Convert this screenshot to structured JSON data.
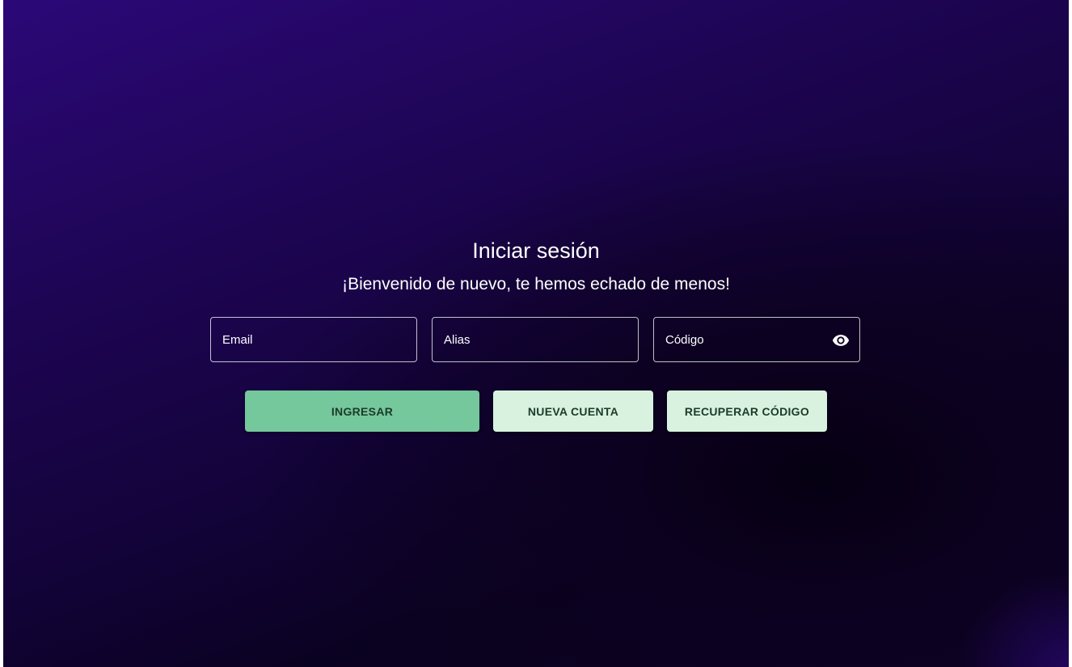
{
  "login": {
    "title": "Iniciar sesión",
    "subtitle": "¡Bienvenido de nuevo, te hemos echado de menos!"
  },
  "fields": {
    "email": {
      "placeholder": "Email",
      "value": ""
    },
    "alias": {
      "placeholder": "Alias",
      "value": ""
    },
    "code": {
      "placeholder": "Código",
      "value": "",
      "toggle_icon": "eye-icon"
    }
  },
  "actions": {
    "login_label": "INGRESAR",
    "new_account_label": "NUEVA CUENTA",
    "recover_code_label": "RECUPERAR CÓDIGO"
  },
  "colors": {
    "background_top": "#2b0878",
    "background_bottom": "#0a0220",
    "primary_button": "#75c79c",
    "secondary_button": "#d9f2df",
    "button_text": "#1c3b2a"
  }
}
